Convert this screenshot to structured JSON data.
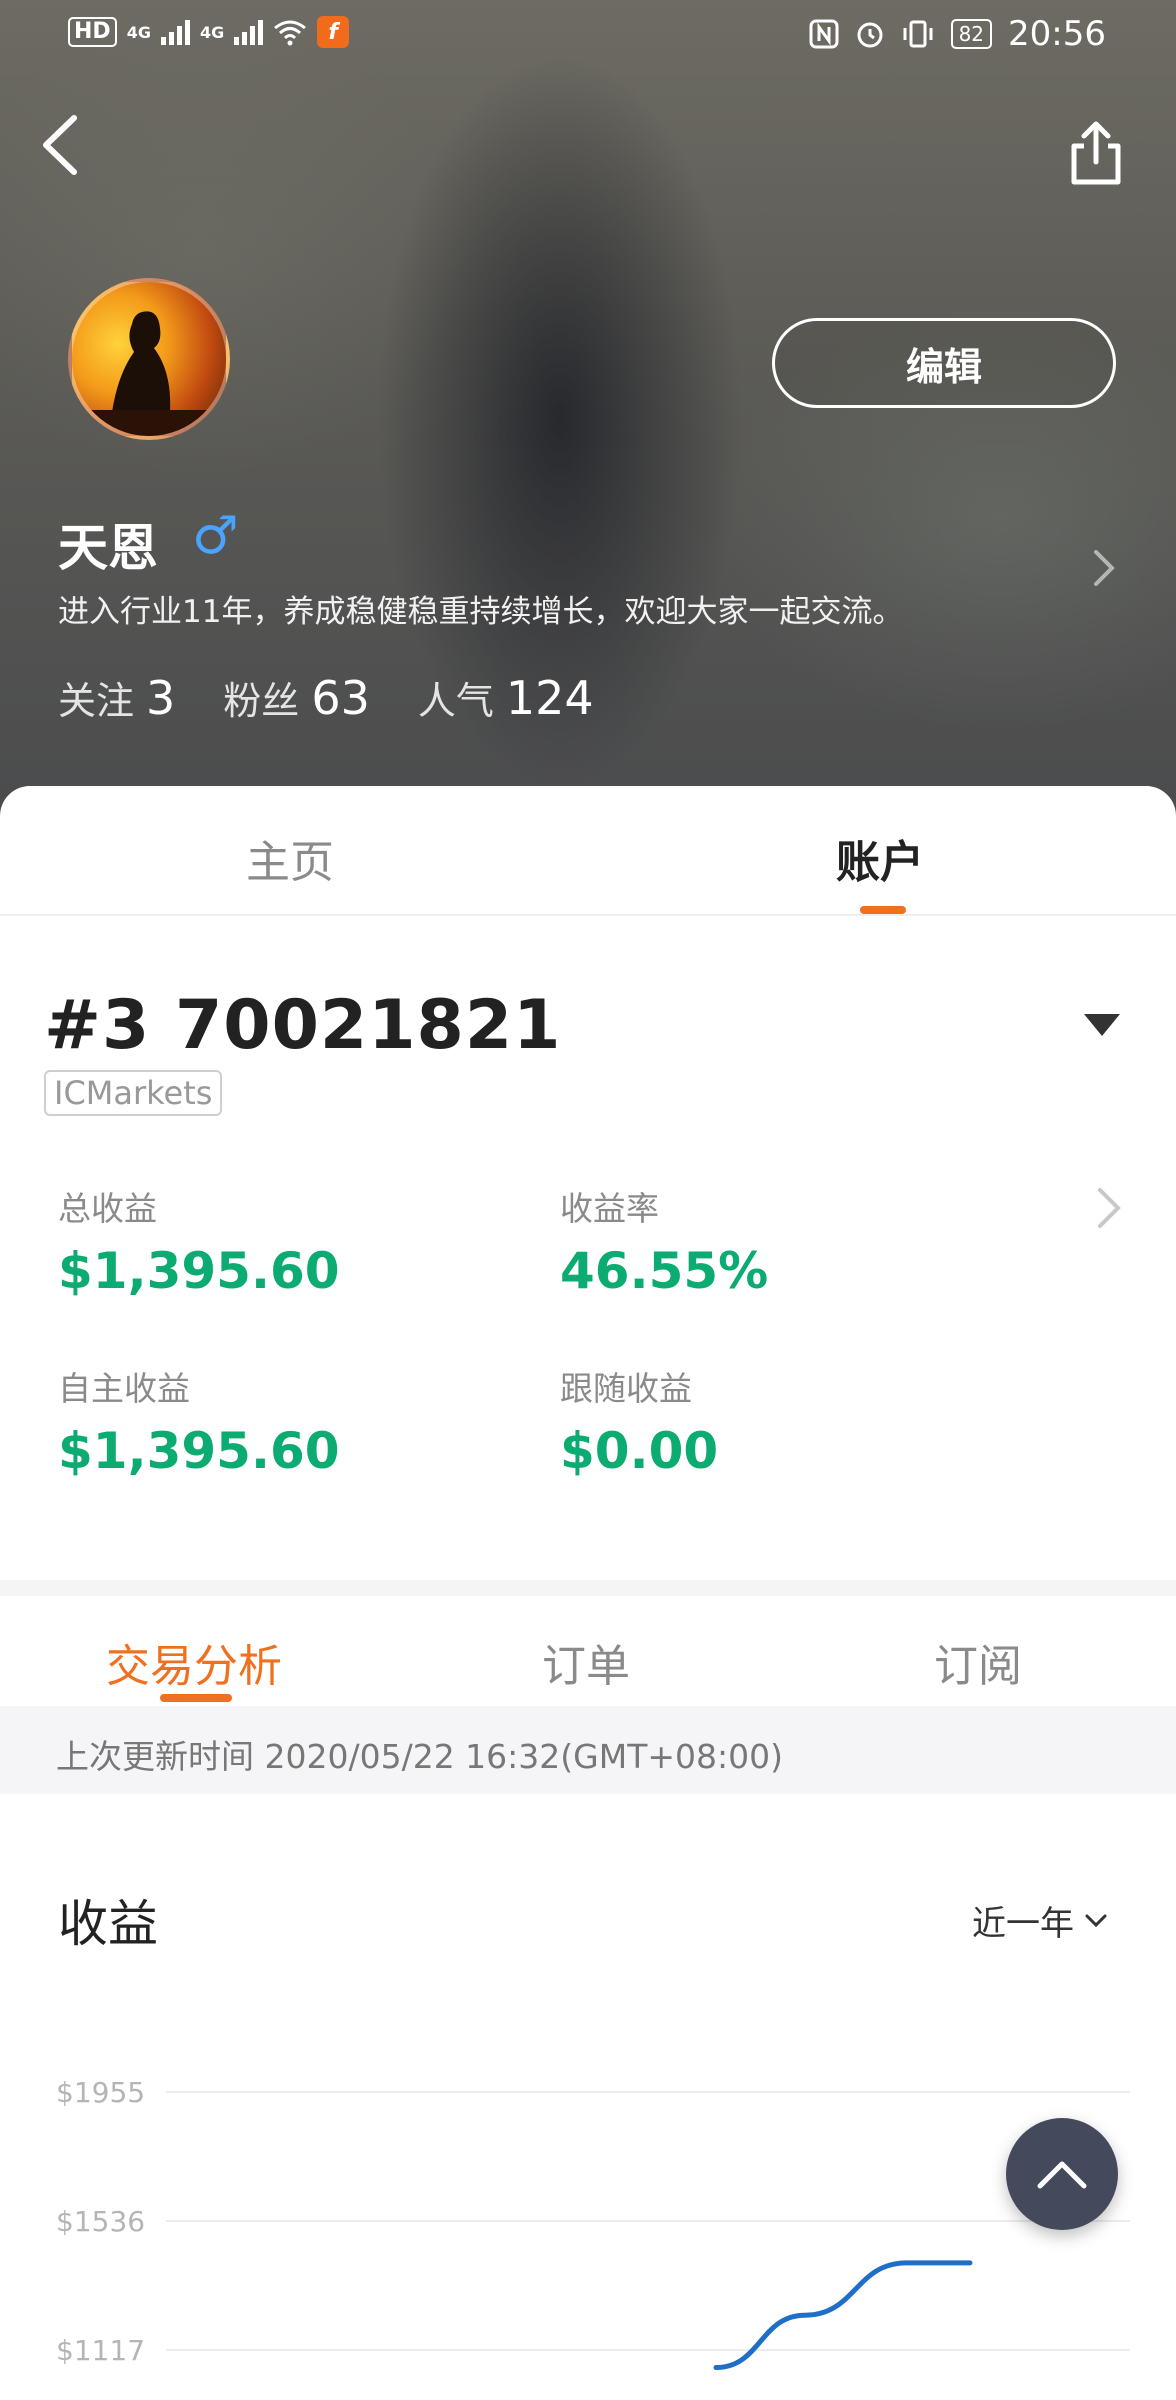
{
  "status_bar": {
    "hd_label": "HD",
    "sim_label": "2",
    "net1": "4G",
    "net2": "4G",
    "battery": "82",
    "time": "20:56"
  },
  "profile": {
    "name": "天恩",
    "gender_symbol": "♂",
    "bio": "进入行业11年，养成稳健稳重持续增长，欢迎大家一起交流。",
    "edit_label": "编辑",
    "stats": [
      {
        "label": "关注",
        "value": "3"
      },
      {
        "label": "粉丝",
        "value": "63"
      },
      {
        "label": "人气",
        "value": "124"
      }
    ]
  },
  "main_tabs": {
    "home": "主页",
    "account": "账户"
  },
  "account": {
    "id": "#3 70021821",
    "broker": "ICMarkets",
    "metrics": {
      "total_profit_label": "总收益",
      "total_profit_value": "$1,395.60",
      "return_rate_label": "收益率",
      "return_rate_value": "46.55%",
      "own_profit_label": "自主收益",
      "own_profit_value": "$1,395.60",
      "follow_profit_label": "跟随收益",
      "follow_profit_value": "$0.00"
    }
  },
  "sub_tabs": {
    "analysis": "交易分析",
    "orders": "订单",
    "subscriptions": "订阅"
  },
  "update_text": "上次更新时间 2020/05/22 16:32(GMT+08:00)",
  "profit_section": {
    "title": "收益",
    "period": "近一年"
  },
  "chart_data": {
    "type": "line",
    "title": "收益",
    "y_ticks": [
      "$1955",
      "$1536",
      "$1117"
    ],
    "ylim": [
      1117,
      1955
    ],
    "grid": true,
    "line_color": "#1f6fc9",
    "series": [
      {
        "points": [
          {
            "t": 0.0,
            "y": 1060
          },
          {
            "t": 0.35,
            "y": 1230
          },
          {
            "t": 0.75,
            "y": 1400
          },
          {
            "t": 1.0,
            "y": 1400
          }
        ]
      }
    ]
  },
  "colors": {
    "accent": "#f0701f",
    "profit_green": "#0bab72",
    "fab": "#444a5c"
  }
}
